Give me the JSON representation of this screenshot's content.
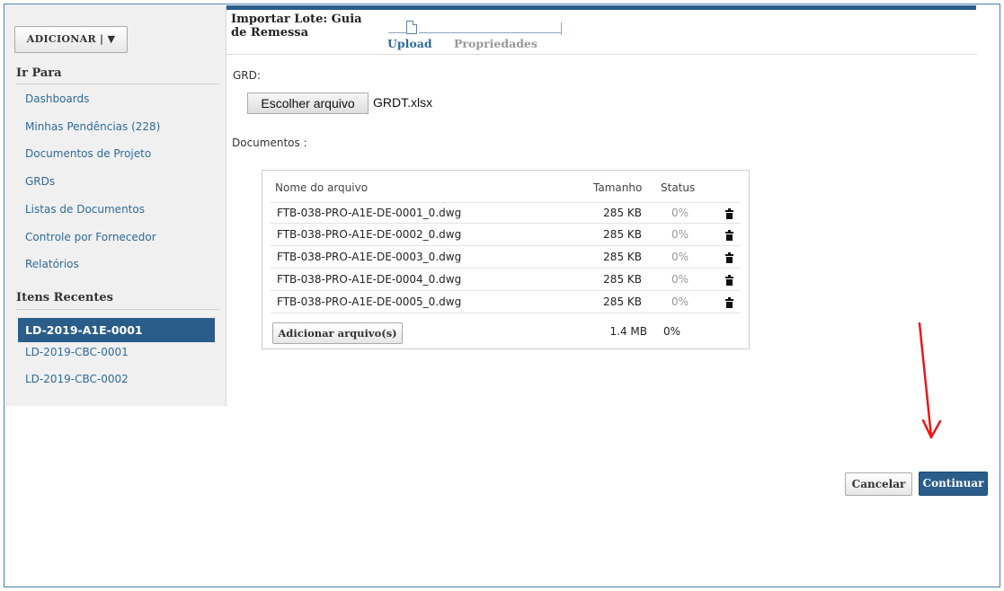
{
  "header": {
    "title": "Importar Lote: Guia de Remessa",
    "steps": [
      {
        "label": "Upload",
        "state": "active"
      },
      {
        "label": "Propriedades",
        "state": "inactive"
      }
    ]
  },
  "sidebar": {
    "add_button": "ADICIONAR | ▼",
    "goto_heading": "Ir Para",
    "goto_items": [
      {
        "label": "Dashboards"
      },
      {
        "label": "Minhas Pendências (228)"
      },
      {
        "label": "Documentos de Projeto"
      },
      {
        "label": "GRDs"
      },
      {
        "label": "Listas de Documentos"
      },
      {
        "label": "Controle por Fornecedor"
      },
      {
        "label": "Relatórios"
      }
    ],
    "recent_heading": "Itens Recentes",
    "recent_items": [
      {
        "label": "LD-2019-A1E-0001",
        "active": true
      },
      {
        "label": "LD-2019-CBC-0001",
        "active": false
      },
      {
        "label": "LD-2019-CBC-0002",
        "active": false
      }
    ]
  },
  "grd": {
    "label": "GRD:",
    "choose_button": "Escolher arquivo",
    "file_name": "GRDT.xlsx"
  },
  "documents": {
    "label": "Documentos :",
    "columns": {
      "name": "Nome do arquivo",
      "size": "Tamanho",
      "status": "Status"
    },
    "rows": [
      {
        "name": "FTB-038-PRO-A1E-DE-0001_0.dwg",
        "size": "285 KB",
        "status": "0%"
      },
      {
        "name": "FTB-038-PRO-A1E-DE-0002_0.dwg",
        "size": "285 KB",
        "status": "0%"
      },
      {
        "name": "FTB-038-PRO-A1E-DE-0003_0.dwg",
        "size": "285 KB",
        "status": "0%"
      },
      {
        "name": "FTB-038-PRO-A1E-DE-0004_0.dwg",
        "size": "285 KB",
        "status": "0%"
      },
      {
        "name": "FTB-038-PRO-A1E-DE-0005_0.dwg",
        "size": "285 KB",
        "status": "0%"
      }
    ],
    "add_button": "Adicionar arquivo(s)",
    "total_size": "1.4 MB",
    "total_status": "0%",
    "row_icon": "trash-icon"
  },
  "footer": {
    "cancel": "Cancelar",
    "continue": "Continuar"
  },
  "colors": {
    "accent": "#2a5d8a",
    "link": "#2f6b9a",
    "annotation": "#e81818"
  }
}
